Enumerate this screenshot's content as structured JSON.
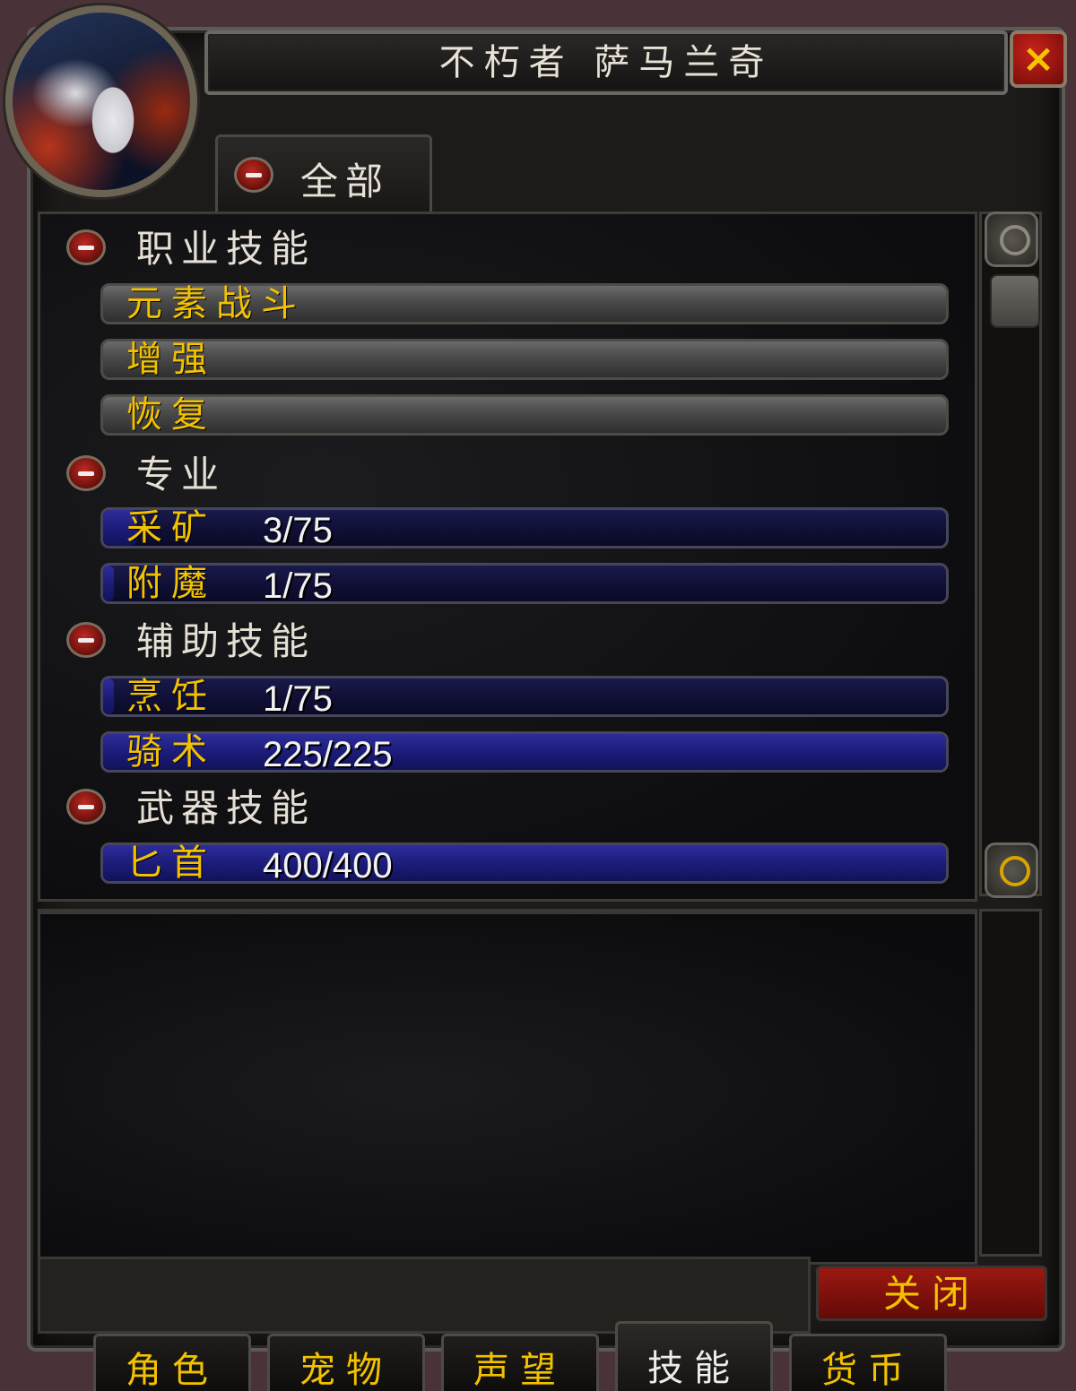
{
  "window": {
    "title": "不朽者 萨马兰奇",
    "close_icon": "×"
  },
  "filter_tab": {
    "label": "全部"
  },
  "categories": [
    {
      "label": "职业技能",
      "skills": [
        {
          "name": "元素战斗",
          "rank": ""
        },
        {
          "name": "增强",
          "rank": ""
        },
        {
          "name": "恢复",
          "rank": ""
        }
      ]
    },
    {
      "label": "专业",
      "skills": [
        {
          "name": "采矿",
          "rank": "3/75",
          "progress": 0.04
        },
        {
          "name": "附魔",
          "rank": "1/75",
          "progress": 0.013
        }
      ]
    },
    {
      "label": "辅助技能",
      "skills": [
        {
          "name": "烹饪",
          "rank": "1/75",
          "progress": 0.013
        },
        {
          "name": "骑术",
          "rank": "225/225",
          "progress": 1.0
        }
      ]
    },
    {
      "label": "武器技能",
      "skills": [
        {
          "name": "匕首",
          "rank": "400/400",
          "progress": 1.0
        }
      ]
    }
  ],
  "footer": {
    "close_label": "关闭"
  },
  "tabs": [
    {
      "label": "角色"
    },
    {
      "label": "宠物"
    },
    {
      "label": "声望"
    },
    {
      "label": "技能"
    },
    {
      "label": "货币"
    }
  ],
  "colors": {
    "skill_name": "#f2c200",
    "bar_blue": "#1c1c7a",
    "close_red": "#9c1812"
  }
}
